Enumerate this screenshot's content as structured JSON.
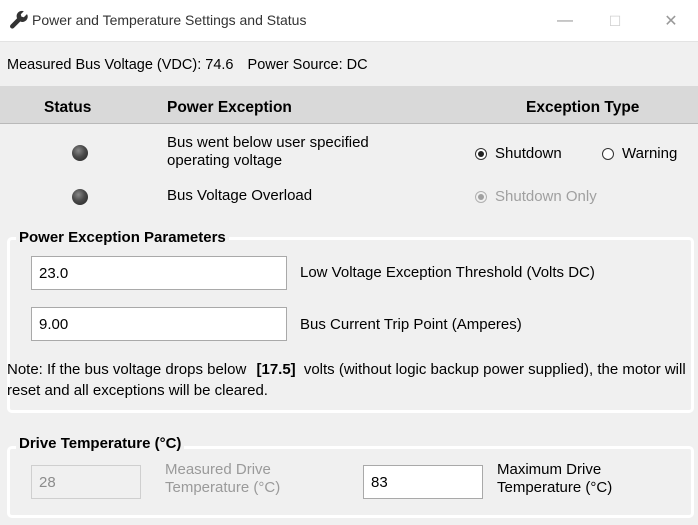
{
  "window": {
    "title": "Power and Temperature Settings and Status",
    "controls": {
      "minimize": "—",
      "maximize": "☐",
      "close": "✕"
    }
  },
  "status_line": {
    "bus_voltage_label": "Measured Bus Voltage (VDC):",
    "bus_voltage_value": "74.6",
    "power_source_label": "Power Source:",
    "power_source_value": "DC"
  },
  "table": {
    "headers": {
      "status": "Status",
      "exception": "Power Exception",
      "type": "Exception Type"
    },
    "rows": [
      {
        "exception": "Bus went below user specified operating voltage",
        "options": [
          {
            "label": "Shutdown",
            "selected": true
          },
          {
            "label": "Warning",
            "selected": false
          }
        ]
      },
      {
        "exception": "Bus Voltage Overload",
        "options": [
          {
            "label": "Shutdown Only",
            "selected": true,
            "disabled": true
          }
        ]
      }
    ]
  },
  "power_params": {
    "title": "Power Exception Parameters",
    "low_voltage_value": "23.0",
    "low_voltage_label": "Low Voltage Exception Threshold (Volts DC)",
    "trip_point_value": "9.00",
    "trip_point_label": "Bus Current Trip Point (Amperes)",
    "note_prefix": "Note: If the bus voltage drops below",
    "note_value": "[17.5]",
    "note_suffix": "volts (without logic backup power supplied), the motor will reset and all exceptions will be cleared."
  },
  "drive_temp": {
    "title": "Drive Temperature (°C)",
    "measured_value": "28",
    "measured_label": "Measured Drive Temperature (°C)",
    "max_value": "83",
    "max_label": "Maximum Drive Temperature (°C)"
  },
  "colors": {
    "window_bg": "#f0f0f0",
    "header_bg": "#d9d9d9",
    "led": "#3a3a3a"
  },
  "icons": {
    "app": "wrench-icon"
  }
}
